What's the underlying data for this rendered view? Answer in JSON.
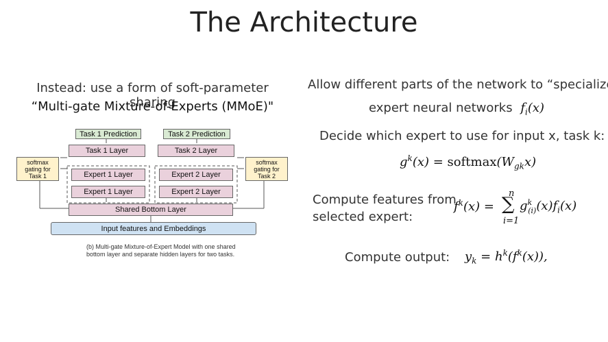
{
  "title": "The Architecture",
  "left": {
    "line1": "Instead: use a form of soft-parameter sharing",
    "line2": "“Multi-gate Mixture-of-Experts (MMoE)\""
  },
  "diagram": {
    "task1_prediction": "Task 1 Prediction",
    "task2_prediction": "Task 2 Prediction",
    "task1_layer": "Task 1 Layer",
    "task2_layer": "Task 2 Layer",
    "gate1": "softmax\ngating for\nTask 1",
    "gate2": "softmax\ngating for\nTask 2",
    "expert1_a": "Expert 1 Layer",
    "expert2_a": "Expert 2 Layer",
    "expert1_b": "Expert 1 Layer",
    "expert2_b": "Expert 2 Layer",
    "shared_bottom": "Shared Bottom Layer",
    "input": "Input features and Embeddings",
    "caption_line1": "(b) Multi-gate Mixture-of-Expert Model with one shared",
    "caption_line2": "bottom layer and separate hidden layers for two tasks."
  },
  "right": {
    "allow": "Allow different parts of the network to “specialize\"",
    "expert_nn": "expert neural networks",
    "expert_nn_math": "fi(x)",
    "decide": "Decide which expert to use for input x, task k:",
    "compute_features_1": "Compute features from",
    "compute_features_2": "selected expert:",
    "compute_output": "Compute output:"
  }
}
